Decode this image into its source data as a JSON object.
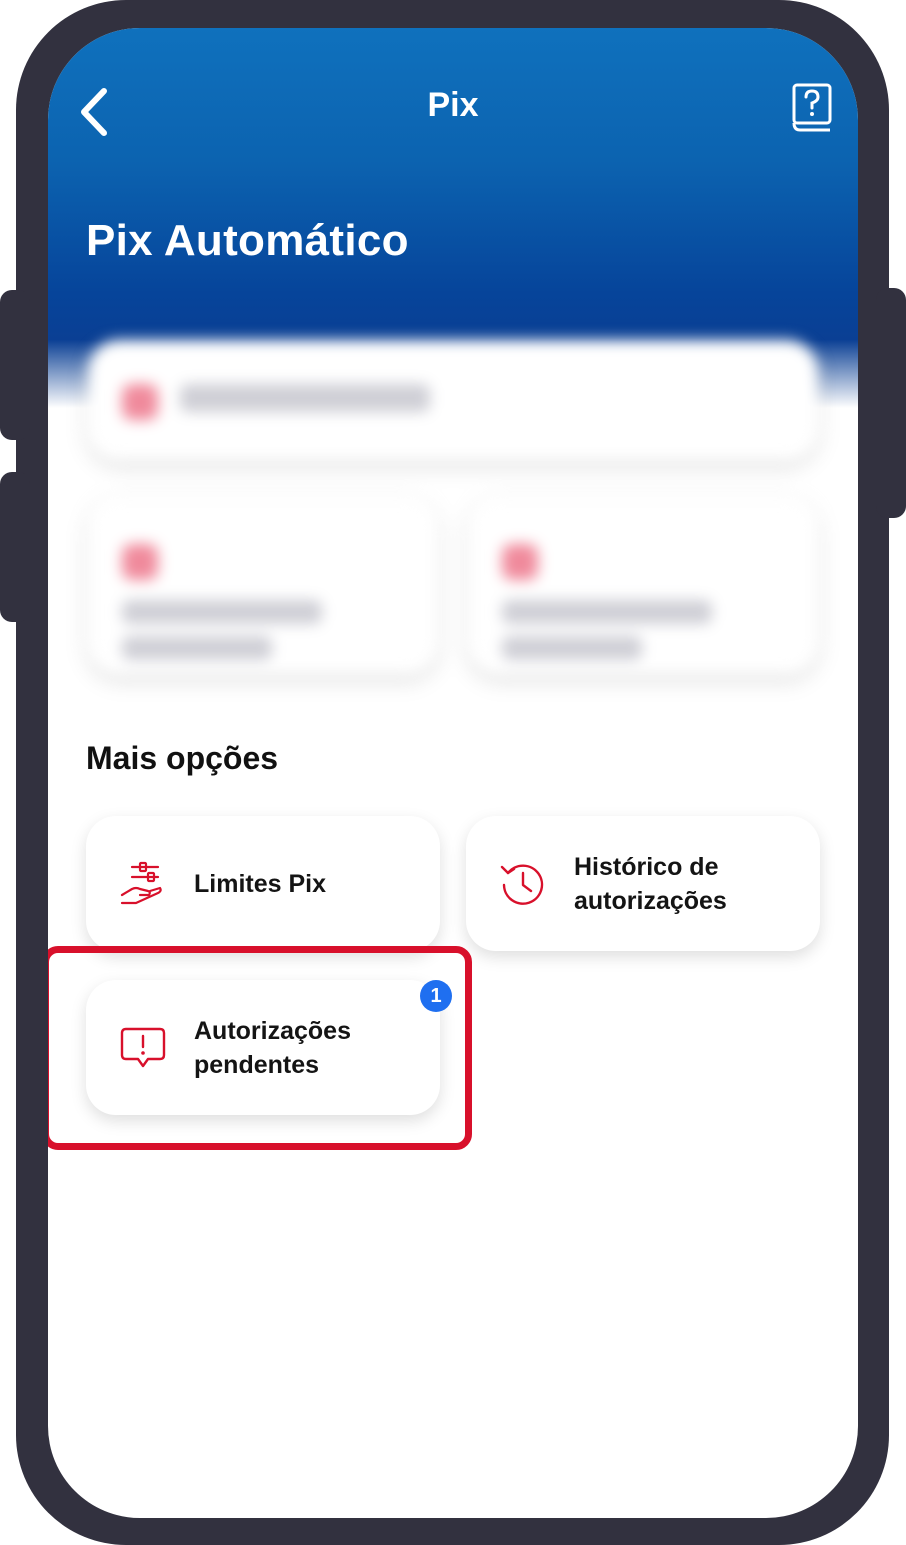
{
  "nav": {
    "title": "Pix",
    "back_icon": "chevron-left-icon",
    "help_icon": "help-book-icon"
  },
  "page": {
    "title": "Pix Automático"
  },
  "section": {
    "title": "Mais opções"
  },
  "options": [
    {
      "label": "Limites Pix",
      "icon": "hand-sliders-icon"
    },
    {
      "label_line1": "Histórico de",
      "label_line2": "autorizações",
      "icon": "history-clock-icon"
    },
    {
      "label_line1": "Autorizações",
      "label_line2": "pendentes",
      "icon": "alert-message-icon",
      "badge": "1"
    }
  ],
  "colors": {
    "header_blue": "#0c63b0",
    "accent_red": "#d8102b",
    "badge_blue": "#1f6ff0",
    "frame": "#32313f"
  }
}
